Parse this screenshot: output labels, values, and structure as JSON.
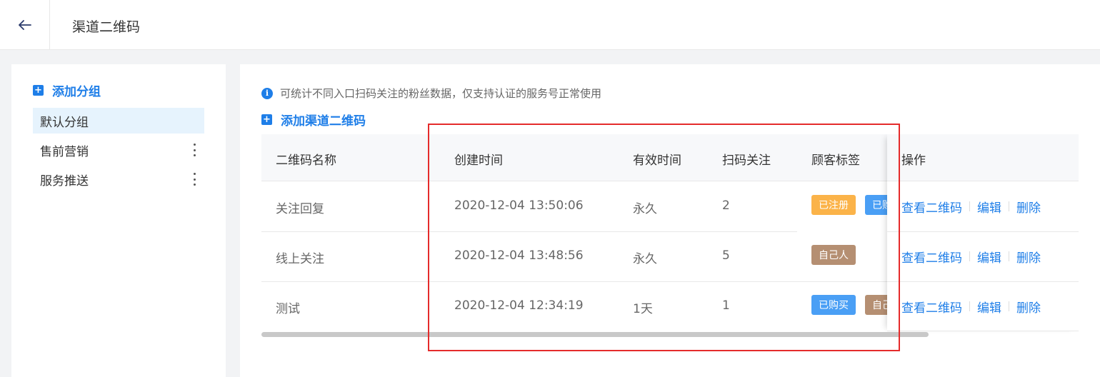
{
  "header": {
    "title": "渠道二维码"
  },
  "sidebar": {
    "add_group_label": "添加分组",
    "groups": [
      {
        "label": "默认分组"
      },
      {
        "label": "售前营销"
      },
      {
        "label": "服务推送"
      }
    ]
  },
  "main": {
    "tip": "可统计不同入口扫码关注的粉丝数据，仅支持认证的服务号正常使用",
    "add_qr_label": "添加渠道二维码"
  },
  "table": {
    "headers": [
      "二维码名称",
      "创建时间",
      "有效时间",
      "扫码关注",
      "顾客标签",
      "操作"
    ],
    "rows": [
      {
        "name": "关注回复",
        "created": "2020-12-04 13:50:06",
        "valid": "永久",
        "scans": "2",
        "tags": [
          {
            "text": "已注册",
            "color": "#fbb349"
          },
          {
            "text": "已购买",
            "color": "#4a9ff5"
          }
        ]
      },
      {
        "name": "线上关注",
        "created": "2020-12-04 13:48:56",
        "valid": "永久",
        "scans": "5",
        "tags": [
          {
            "text": "自己人",
            "color": "#b58f72"
          }
        ]
      },
      {
        "name": "测试",
        "created": "2020-12-04 12:34:19",
        "valid": "1天",
        "scans": "1",
        "tags": [
          {
            "text": "已购买",
            "color": "#4a9ff5"
          },
          {
            "text": "自己人",
            "color": "#b58f72"
          }
        ]
      }
    ],
    "actions": {
      "view": "查看二维码",
      "edit": "编辑",
      "delete": "删除"
    }
  },
  "colors": {
    "accent": "#1e7ee8",
    "highlight_border": "#e52b2b"
  }
}
